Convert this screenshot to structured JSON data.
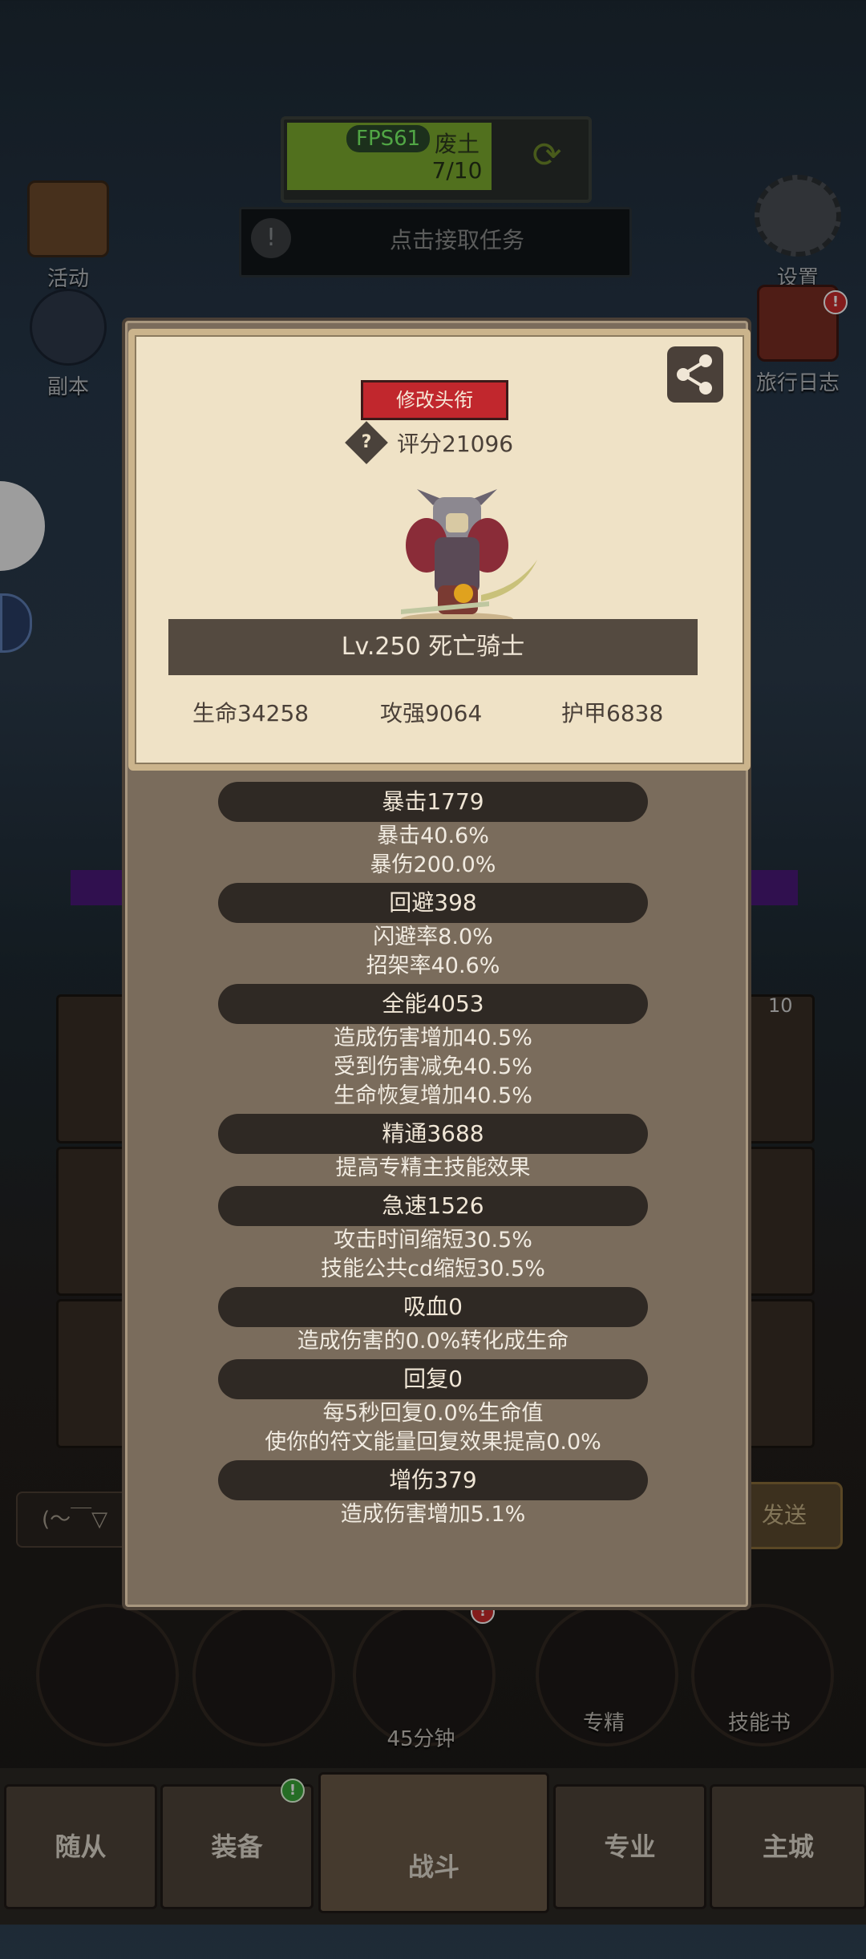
{
  "hud": {
    "fps": "FPS61",
    "quest_name": "废土",
    "quest_progress": "7/10",
    "task_text": "点击接取任务",
    "task_icon": "!"
  },
  "side_buttons": {
    "activity": "活动",
    "dungeon": "副本",
    "settings": "设置",
    "journal": "旅行日志",
    "journal_badge": "!"
  },
  "background": {
    "slot_count": "10",
    "chat_hint": "(～￣▽",
    "send_label": "发送",
    "timer_label": "45分钟",
    "mastery_label": "专精",
    "skillbook_label": "技能书",
    "chest_badge": "!",
    "equip_badge": "!"
  },
  "bottom_nav": {
    "followers": "随从",
    "equipment": "装备",
    "battle": "战斗",
    "profession": "专业",
    "main_city": "主城"
  },
  "profile": {
    "edit_title_label": "修改头衔",
    "score_label": "评分21096",
    "score_help_icon": "?",
    "level_text": "Lv.250 死亡骑士",
    "hp": "生命34258",
    "attack": "攻强9064",
    "armor": "护甲6838"
  },
  "stats": [
    {
      "head": "暴击1779",
      "lines": [
        "暴击40.6%",
        "暴伤200.0%"
      ]
    },
    {
      "head": "回避398",
      "lines": [
        "闪避率8.0%",
        "招架率40.6%"
      ]
    },
    {
      "head": "全能4053",
      "lines": [
        "造成伤害增加40.5%",
        "受到伤害减免40.5%",
        "生命恢复增加40.5%"
      ]
    },
    {
      "head": "精通3688",
      "lines": [
        "提高专精主技能效果"
      ]
    },
    {
      "head": "急速1526",
      "lines": [
        "攻击时间缩短30.5%",
        "技能公共cd缩短30.5%"
      ]
    },
    {
      "head": "吸血0",
      "lines": [
        "造成伤害的0.0%转化成生命"
      ]
    },
    {
      "head": "回复0",
      "lines": [
        "每5秒回复0.0%生命值",
        "使你的符文能量回复效果提高0.0%"
      ]
    },
    {
      "head": "增伤379",
      "lines": [
        "造成伤害增加5.1%"
      ]
    }
  ]
}
